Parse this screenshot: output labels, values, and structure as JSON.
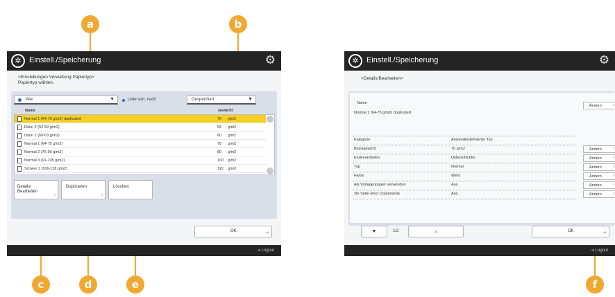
{
  "callouts": {
    "a": "a",
    "b": "b",
    "c": "c",
    "d": "d",
    "e": "e",
    "f": "f"
  },
  "left": {
    "title": "Einstell./Speicherung",
    "subtitle_line1": "<Einstellungen Verwaltung Papiertyp>",
    "subtitle_line2": "Papiertyp wählen.",
    "filter_value": "Alle",
    "sort_label": "Liste sort. nach",
    "sort_value": "Gespeichert",
    "col_name": "Name",
    "col_weight": "Gewicht",
    "rows": [
      {
        "name": "Normal 1 (64-75 g/m2) duplicated",
        "weight": "70",
        "unit": "g/m2"
      },
      {
        "name": "Dünn 2 (52-59 g/m2)",
        "weight": "55",
        "unit": "g/m2"
      },
      {
        "name": "Dünn 1 (60-63 g/m2)",
        "weight": "60",
        "unit": "g/m2"
      },
      {
        "name": "Normal 1 (64-75 g/m2)",
        "weight": "70",
        "unit": "g/m2"
      },
      {
        "name": "Normal 2 (76-90 g/m2)",
        "weight": "80",
        "unit": "g/m2"
      },
      {
        "name": "Normal 3 (91-105 g/m2)",
        "weight": "100",
        "unit": "g/m2"
      },
      {
        "name": "Schwer 1 (106-128 g/m2)",
        "weight": "110",
        "unit": "g/m2"
      }
    ],
    "btn_details_1": "Details/",
    "btn_details_2": "Bearbeiten",
    "btn_duplicate": "Duplizieren",
    "btn_delete": "Löschen",
    "btn_ok": "OK",
    "logout": "Logout"
  },
  "right": {
    "title": "Einstell./Speicherung",
    "subtitle": "<Details/Bearbeiten>",
    "name_label": "Name",
    "name_value": "Normal 1 (64-75 g/m2) duplicated",
    "change_label": "Ändern",
    "rows": [
      {
        "key": "Kategorie",
        "value": "Anwenderdefinierter Typ",
        "editable": false
      },
      {
        "key": "Basisgewicht",
        "value": "70 g/m2",
        "editable": true
      },
      {
        "key": "Endverarbeiten",
        "value": "Unbeschichtet",
        "editable": true
      },
      {
        "key": "Typ",
        "value": "Normal",
        "editable": true
      },
      {
        "key": "Farbe",
        "value": "Weiß",
        "editable": true
      },
      {
        "key": "Als Vorlagenpapier verwenden",
        "value": "Aus",
        "editable": true
      },
      {
        "key": "2te Seite einer Doppelseite",
        "value": "Aus",
        "editable": true
      }
    ],
    "page_indicator": "1/2",
    "btn_ok": "OK",
    "logout": "Logout"
  },
  "colors": {
    "accent": "#f0a830",
    "selected_row": "#f5d020",
    "titlebar": "#242424"
  }
}
